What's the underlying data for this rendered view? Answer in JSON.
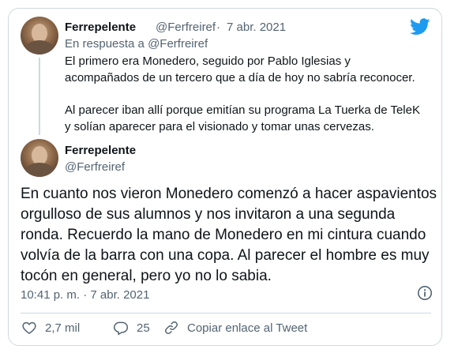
{
  "reply_tweet": {
    "display_name": "Ferrepelente",
    "handle": "@Ferfreiref",
    "separator": "·",
    "date": "7 abr. 2021",
    "in_reply_to": "En respuesta a @Ferfreiref",
    "paragraphs": [
      "El primero era Monedero, seguido por Pablo Iglesias y acompañados de un tercero que a día de hoy no sabría reconocer.",
      "Al parecer iban allí porque emitían su programa La Tuerka de TeleK y solían aparecer para el visionado y tomar unas cervezas."
    ]
  },
  "main_tweet": {
    "display_name": "Ferrepelente",
    "handle": "@Ferfreiref",
    "text": "En cuanto nos vieron Monedero comenzó a hacer aspavientos orgulloso de sus alumnos y nos invitaron a una segunda ronda. Recuerdo la mano de Monedero en mi cintura cuando volvía de la barra con una copa. Al parecer el hombre es muy tocón en general, pero yo no lo sabia.",
    "timestamp": "10:41 p. m. · 7 abr. 2021"
  },
  "actions": {
    "likes": "2,7 mil",
    "replies": "25",
    "copy_link": "Copiar enlace al Tweet"
  },
  "icons": {
    "brand": "twitter-bird-icon",
    "like": "heart-icon",
    "reply": "comment-bubble-icon",
    "copy": "link-icon",
    "info": "info-icon"
  },
  "colors": {
    "brand_blue": "#1d9bf0",
    "text": "#0f1419",
    "muted": "#536471",
    "border": "#cfd9de"
  }
}
